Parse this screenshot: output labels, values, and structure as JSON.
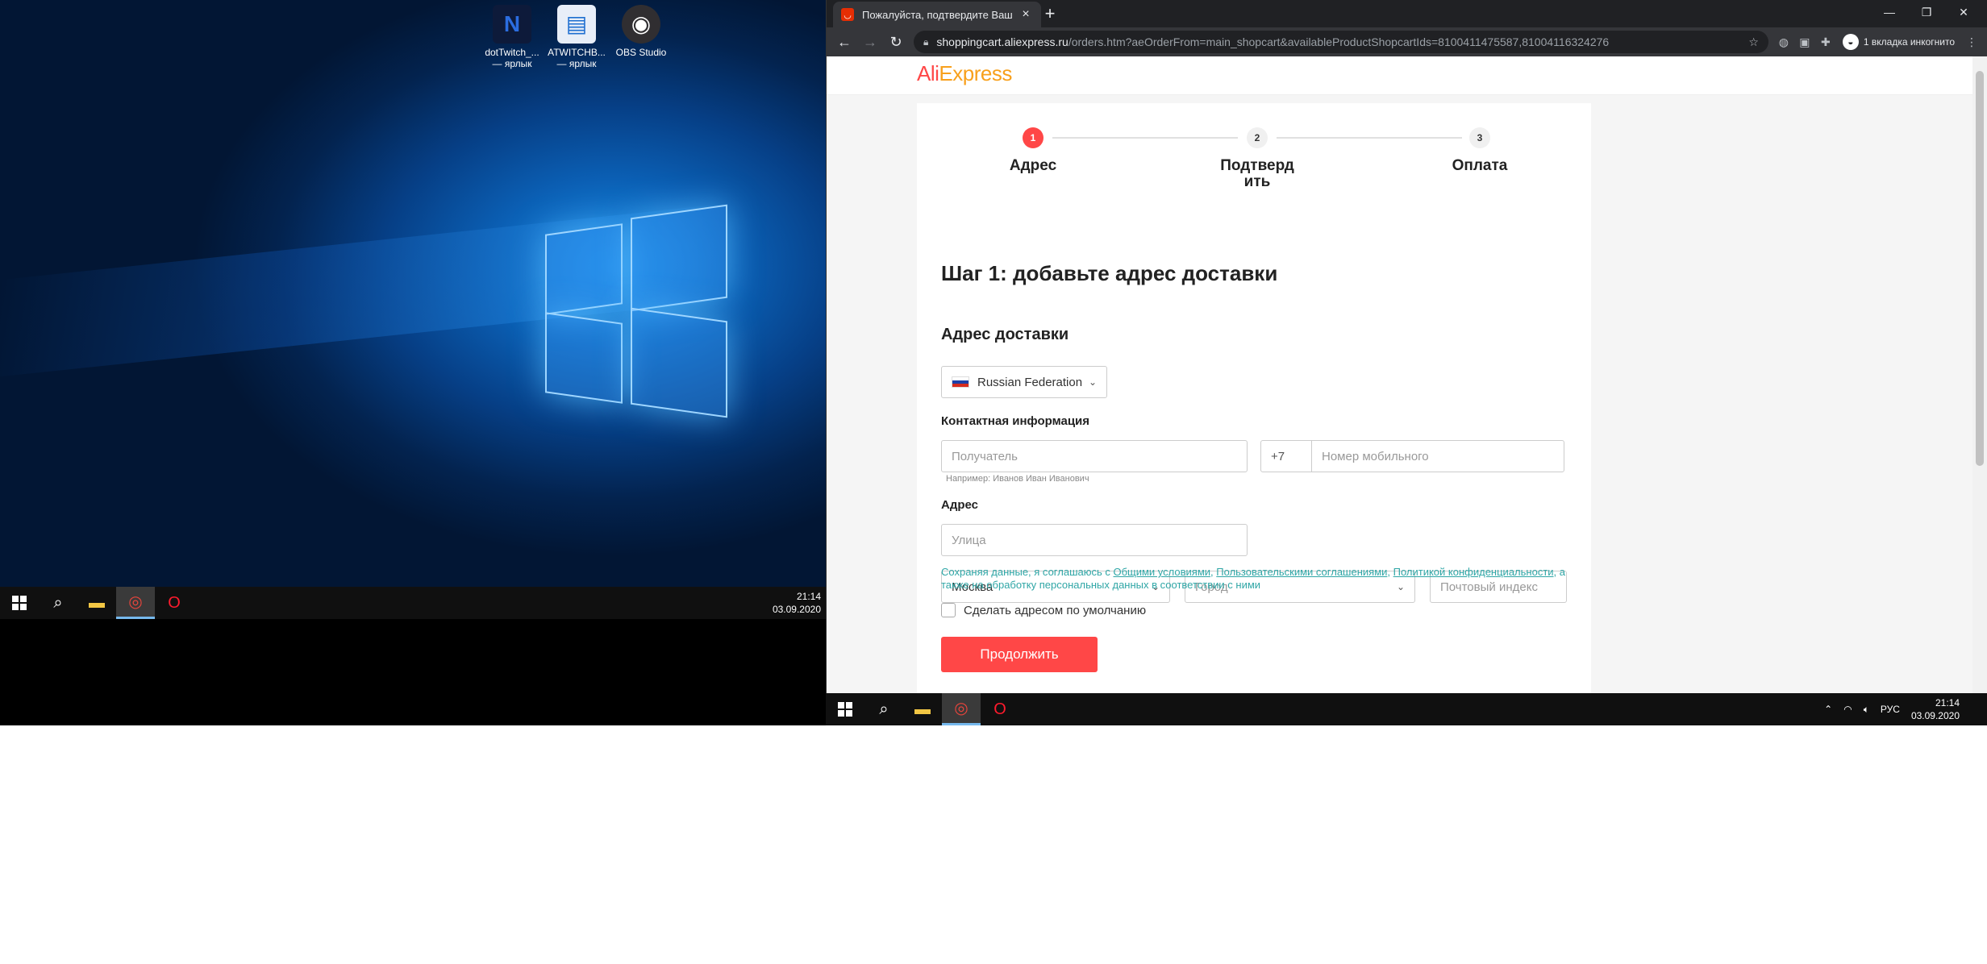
{
  "desktop": {
    "icons": [
      {
        "name": "dotTwitch_...",
        "sub": "— ярлык",
        "glyph": "N"
      },
      {
        "name": "ATWITCHB...",
        "sub": "— ярлык",
        "glyph": "▤"
      },
      {
        "name": "OBS Studio",
        "sub": "",
        "glyph": "◉"
      }
    ],
    "taskbar": {
      "time": "21:14",
      "date": "03.09.2020"
    }
  },
  "browser": {
    "tab_title": "Пожалуйста, подтвердите Ваш",
    "url_host": "shoppingcart.aliexpress.ru",
    "url_path": "/orders.htm?aeOrderFrom=main_shopcart&availableProductShopcartIds=8100411475587,81004116324276",
    "incognito_label": "1 вкладка инкогнито"
  },
  "page": {
    "logo_a": "Ali",
    "logo_b": "Express",
    "steps": [
      {
        "num": "1",
        "label": "Адрес"
      },
      {
        "num": "2",
        "label": "Подтверд ить"
      },
      {
        "num": "3",
        "label": "Оплата"
      }
    ],
    "title": "Шаг 1: добавьте адрес доставки",
    "subtitle": "Адрес доставки",
    "country": "Russian Federation",
    "contact_label": "Контактная информация",
    "recipient_placeholder": "Получатель",
    "phone_code": "+7",
    "phone_placeholder": "Номер мобильного",
    "recipient_hint": "Например: Иванов Иван Иванович",
    "address_label": "Адрес",
    "street_placeholder": "Улица",
    "region": "Москва",
    "city_placeholder": "Город",
    "zip_placeholder": "Почтовый индекс",
    "agree_prefix": "Сохраняя данные, я соглашаюсь с ",
    "agree_link1": "Общими условиями",
    "agree_sep1": ", ",
    "agree_link2": "Пользовательскими соглашениями",
    "agree_sep2": ", ",
    "agree_link3": "Политикой конфиденциальности",
    "agree_suffix": ", а также на обработку персональных данных в соответствии с ними",
    "default_checkbox": "Сделать адресом по умолчанию",
    "continue_button": "Продолжить"
  },
  "taskbar_right": {
    "lang": "РУС",
    "time": "21:14",
    "date": "03.09.2020"
  },
  "colors": {
    "accent": "#ff4747",
    "link": "#2fa6a6"
  }
}
